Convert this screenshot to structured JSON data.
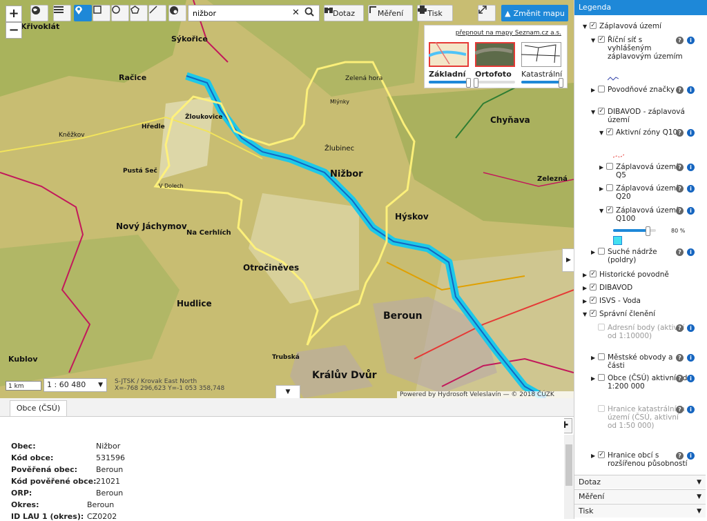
{
  "toolbar": {
    "search_value": "nižbor",
    "query_label": "Dotaz",
    "measure_label": "Měření",
    "print_label": "Tisk",
    "change_map_label": "Změnit mapu",
    "zoom_in": "+",
    "zoom_out": "−"
  },
  "basemaps": {
    "link": "přepnout na mapy Seznam.cz a.s.",
    "items": [
      {
        "label": "Základní",
        "opacity": 0.98
      },
      {
        "label": "Ortofoto",
        "opacity": 0.02
      },
      {
        "label": "Katastrální",
        "opacity": 0.98
      }
    ]
  },
  "map": {
    "scalebar": "1 km",
    "scale": "1 : 60 480",
    "coords_line1": "S-JTSK / Krovak East North",
    "coords_line2": "X=-768 296,623 Y=-1 053 358,748",
    "attribution": "Powered by Hydrosoft Veleslavín — © 2018 ČÚZK",
    "labels": [
      "Křivoklát",
      "Sýkořice",
      "Račice",
      "Žloukovice",
      "Hředle",
      "Pustá Seč",
      "Nový Jáchymov",
      "Na Cerhlích",
      "Otročiněves",
      "Hudlice",
      "Kublov",
      "Trubská",
      "Králův Dvůr",
      "Beroun",
      "Hýskov",
      "Nižbor",
      "Chyňava",
      "Zelená hora",
      "Žlubinec",
      "Kněžkov",
      "Zelezná",
      "V Dolech",
      "Mlýnky"
    ]
  },
  "legend": {
    "title": "Legenda",
    "items": [
      {
        "text": "Záplavová území",
        "checked": true,
        "twist": "▼",
        "indent": 0
      },
      {
        "text": "Říční síť s vyhlášeným záplavovým územím",
        "checked": true,
        "twist": "▼",
        "indent": 1
      },
      {
        "text": "Povodňové značky",
        "checked": false,
        "twist": "▶",
        "indent": 1
      },
      {
        "text": "DIBAVOD - záplavová území",
        "checked": true,
        "twist": "▼",
        "indent": 1
      },
      {
        "text": "Aktivní zóny Q100",
        "checked": true,
        "twist": "▼",
        "indent": 2
      },
      {
        "text": "Záplavová území Q5",
        "checked": false,
        "twist": "▶",
        "indent": 2
      },
      {
        "text": "Záplavová území Q20",
        "checked": false,
        "twist": "▶",
        "indent": 2
      },
      {
        "text": "Záplavová území Q100",
        "checked": true,
        "twist": "▼",
        "indent": 2
      },
      {
        "text": "Suché nádrže (poldry)",
        "checked": false,
        "twist": "▶",
        "indent": 1
      },
      {
        "text": "Historické povodně",
        "checked": true,
        "twist": "▶",
        "indent": 0
      },
      {
        "text": "DIBAVOD",
        "checked": true,
        "twist": "▶",
        "indent": 0
      },
      {
        "text": "ISVS - Voda",
        "checked": true,
        "twist": "▶",
        "indent": 0
      },
      {
        "text": "Správní členění",
        "checked": true,
        "twist": "▼",
        "indent": 0
      },
      {
        "text": "Adresní body (aktivní od 1:10000)",
        "checked": false,
        "twist": "",
        "indent": 1,
        "disabled": true
      },
      {
        "text": "Městské obvody a části",
        "checked": false,
        "twist": "▶",
        "indent": 1
      },
      {
        "text": "Obce (ČSÚ) aktivní od 1:200 000",
        "checked": false,
        "twist": "▶",
        "indent": 1
      },
      {
        "text": "Hranice katastrálních území (ČSÚ, aktivní od 1:50 000)",
        "checked": false,
        "twist": "",
        "indent": 1,
        "disabled": true
      },
      {
        "text": "Hranice obcí s rozšířenou působností",
        "checked": true,
        "twist": "▶",
        "indent": 1
      }
    ],
    "q100_opacity": "80 %",
    "q100_opacity_value": 0.8,
    "accordion": [
      "Dotaz",
      "Měření",
      "Tisk"
    ]
  },
  "bottom": {
    "tab": "Obce (ČSÚ)",
    "rows": [
      {
        "k": "Obec:",
        "v": "Nižbor"
      },
      {
        "k": "Kód obce:",
        "v": "531596"
      },
      {
        "k": "Pověřená obec:",
        "v": "Beroun"
      },
      {
        "k": "Kód pověřené obce:",
        "v": "21021"
      },
      {
        "k": "ORP:",
        "v": "Beroun"
      },
      {
        "k": "Okres:",
        "v": "Beroun"
      },
      {
        "k": "ID LAU 1 (okres):",
        "v": "CZ0202"
      }
    ]
  }
}
